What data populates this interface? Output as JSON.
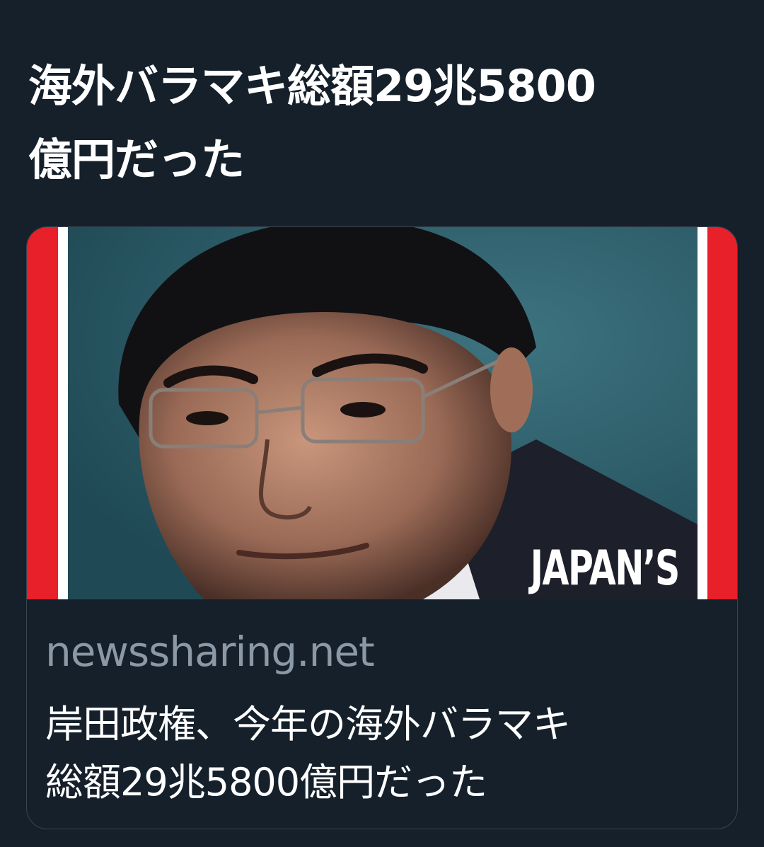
{
  "tweet": {
    "text": "海外バラマキ総額29兆5800\n億円だった"
  },
  "card": {
    "image_text": "JAPAN’S",
    "domain": "newssharing.net",
    "title": "岸田政権、今年の海外バラマキ\n総額29兆5800億円だった"
  },
  "colors": {
    "background": "#15202b",
    "border": "#38444d",
    "domain_text": "#8b98a5",
    "cover_red": "#e8202a"
  }
}
